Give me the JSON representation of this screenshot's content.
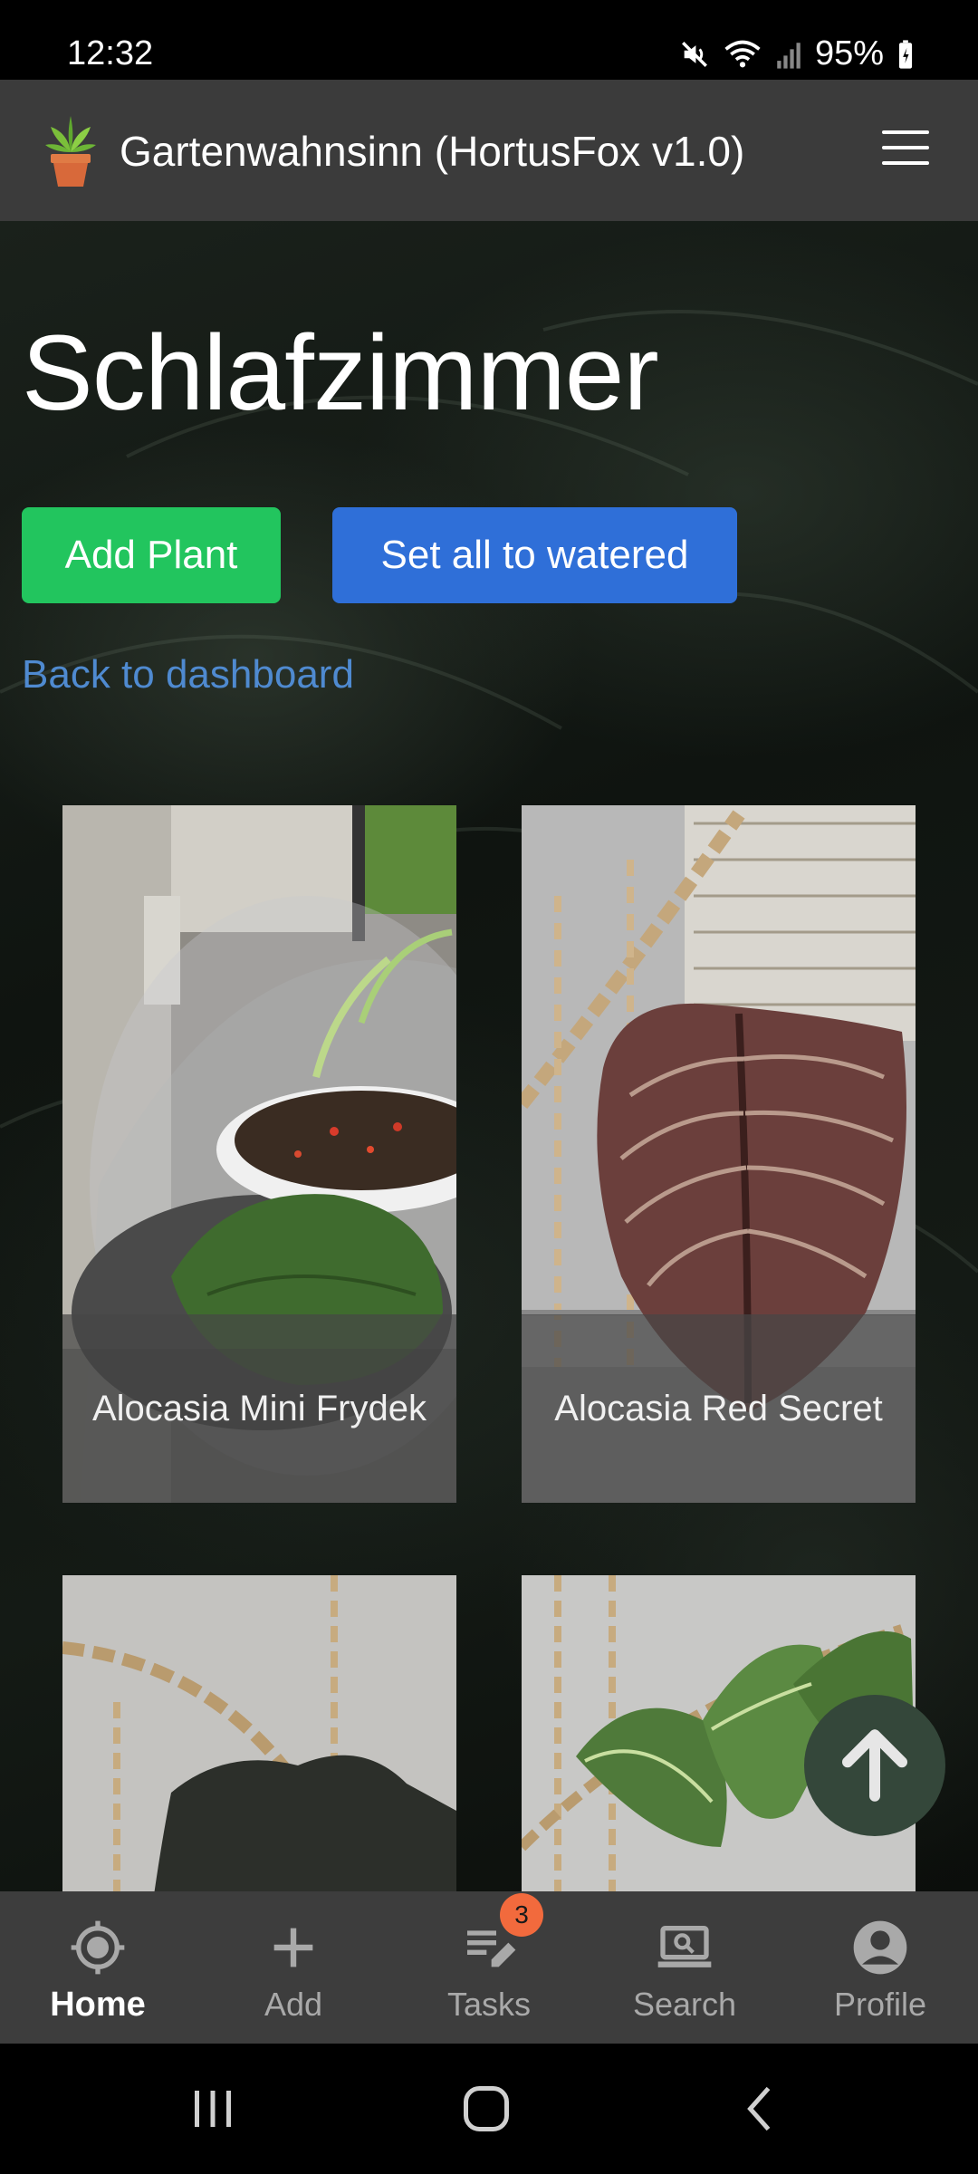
{
  "status_bar": {
    "time": "12:32",
    "battery": "95%",
    "icons": [
      "mute-icon",
      "wifi-icon",
      "signal-icon",
      "battery-charging-icon"
    ]
  },
  "header": {
    "title": "Gartenwahnsinn (HortusFox v1.0)",
    "logo_icon": "potted-plant-icon",
    "menu_icon": "hamburger-menu-icon",
    "background_color": "#3b3b3b"
  },
  "page": {
    "title": "Schlafzimmer",
    "add_plant_label": "Add Plant",
    "set_watered_label": "Set all to watered",
    "back_link": "Back to dashboard",
    "colors": {
      "add_plant": "#22c55e",
      "set_watered": "#2f6fd8",
      "link": "#4f8ad0"
    }
  },
  "plants": [
    {
      "name": "Alocasia Mini Frydek"
    },
    {
      "name": "Alocasia Red Secret"
    },
    {
      "name": ""
    },
    {
      "name": ""
    }
  ],
  "scroll_top": {
    "icon": "arrow-up-icon"
  },
  "bottom_nav": {
    "items": [
      {
        "label": "Home",
        "icon": "home-target-icon",
        "active": true
      },
      {
        "label": "Add",
        "icon": "plus-icon",
        "active": false
      },
      {
        "label": "Tasks",
        "icon": "tasks-edit-icon",
        "active": false,
        "badge": "3"
      },
      {
        "label": "Search",
        "icon": "search-laptop-icon",
        "active": false
      },
      {
        "label": "Profile",
        "icon": "account-circle-icon",
        "active": false
      }
    ]
  },
  "system_nav": {
    "icons": [
      "recents-icon",
      "home-icon",
      "back-icon"
    ]
  }
}
